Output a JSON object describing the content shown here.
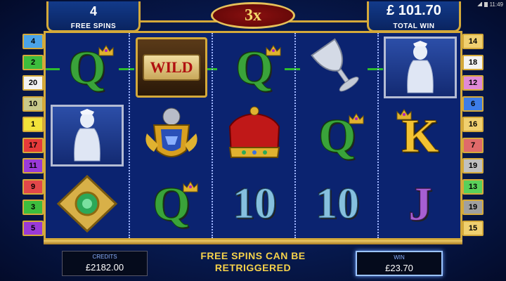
{
  "status_bar": {
    "time": "11:49"
  },
  "free_spins": {
    "count": "4",
    "label": "FREE SPINS"
  },
  "total_win": {
    "amount": "£ 101.70",
    "label": "TOTAL WIN"
  },
  "multiplier": "3x",
  "paylines_left": [
    {
      "n": "4",
      "color": "#4aa3e8"
    },
    {
      "n": "2",
      "color": "#3dbd3d"
    },
    {
      "n": "20",
      "color": "#f3f3f3"
    },
    {
      "n": "10",
      "color": "#c9c98a"
    },
    {
      "n": "1",
      "color": "#f2e33a"
    },
    {
      "n": "17",
      "color": "#e63a3a"
    },
    {
      "n": "11",
      "color": "#9a3ad8"
    },
    {
      "n": "9",
      "color": "#e2474a"
    },
    {
      "n": "3",
      "color": "#3dbd3d"
    },
    {
      "n": "5",
      "color": "#9a3ad8"
    }
  ],
  "paylines_right": [
    {
      "n": "14",
      "color": "#f0d070"
    },
    {
      "n": "18",
      "color": "#f3f3f3"
    },
    {
      "n": "12",
      "color": "#e08ad8"
    },
    {
      "n": "6",
      "color": "#3d7de8"
    },
    {
      "n": "16",
      "color": "#f0d070"
    },
    {
      "n": "7",
      "color": "#e06a6a"
    },
    {
      "n": "19",
      "color": "#c0c0c0"
    },
    {
      "n": "13",
      "color": "#5ad05a"
    },
    {
      "n": "19",
      "color": "#a0a0a0"
    },
    {
      "n": "15",
      "color": "#f0d070"
    }
  ],
  "reels": [
    [
      "Q",
      "ghost",
      "amulet"
    ],
    [
      "WILD",
      "crest",
      "Q"
    ],
    [
      "Q",
      "crown",
      "10"
    ],
    [
      "goblet",
      "Q",
      "10"
    ],
    [
      "ghost",
      "K",
      "J"
    ]
  ],
  "credits": {
    "label": "CREDITS",
    "value": "£2182.00"
  },
  "win": {
    "label": "WIN",
    "value": "£23.70"
  },
  "message": "FREE SPINS CAN BE RETRIGGERED",
  "symbols": {
    "wild_label": "WILD"
  }
}
